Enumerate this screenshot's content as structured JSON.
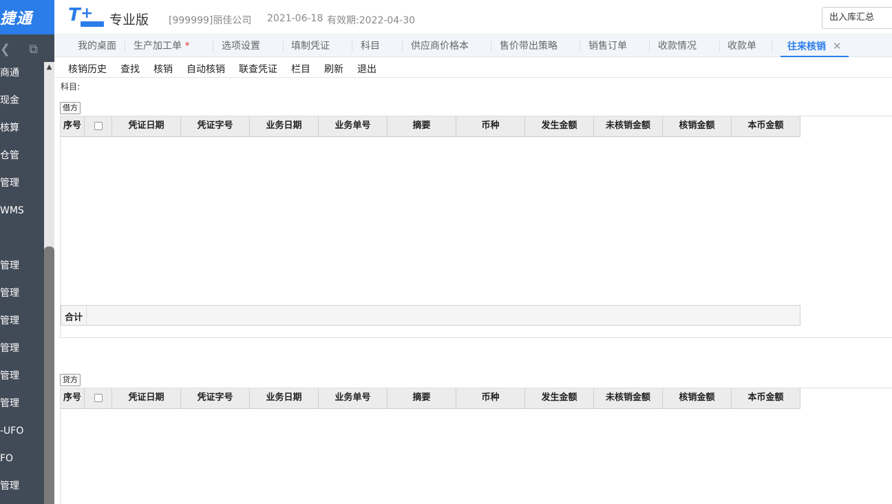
{
  "sidebar": {
    "brand": "捷通",
    "items": [
      "商通",
      "现金",
      "核算",
      "仓管",
      "管理",
      "WMS",
      "",
      "管理",
      "管理",
      "管理",
      "管理",
      "管理",
      "管理",
      "-UFO",
      "FO",
      "管理"
    ]
  },
  "header": {
    "edition": "专业版",
    "company": "[999999]丽佳公司",
    "date": "2021-06-18",
    "valid": "有效期:2022-04-30",
    "search_value": "出入库汇总"
  },
  "tabs": [
    "我的桌面",
    "生产加工单",
    "选项设置",
    "填制凭证",
    "科目",
    "供应商价格本",
    "售价带出策略",
    "销售订单",
    "收款情况",
    "收款单",
    "往来核销"
  ],
  "tab_marks": {
    "modified": "*",
    "close": "✕"
  },
  "toolbar": [
    "核销历史",
    "查找",
    "核销",
    "自动核销",
    "联查凭证",
    "栏目",
    "刷新",
    "退出"
  ],
  "subject_label": "科目:",
  "debit": {
    "tag": "借方",
    "columns": [
      "序号",
      "",
      "凭证日期",
      "凭证字号",
      "业务日期",
      "业务单号",
      "摘要",
      "币种",
      "发生金额",
      "未核销金额",
      "核销金额",
      "本币金额"
    ],
    "total_label": "合计"
  },
  "credit": {
    "tag": "贷方",
    "columns": [
      "序号",
      "",
      "凭证日期",
      "凭证字号",
      "业务日期",
      "业务单号",
      "摘要",
      "币种",
      "发生金额",
      "未核销金额",
      "核销金额",
      "本币金额"
    ]
  }
}
